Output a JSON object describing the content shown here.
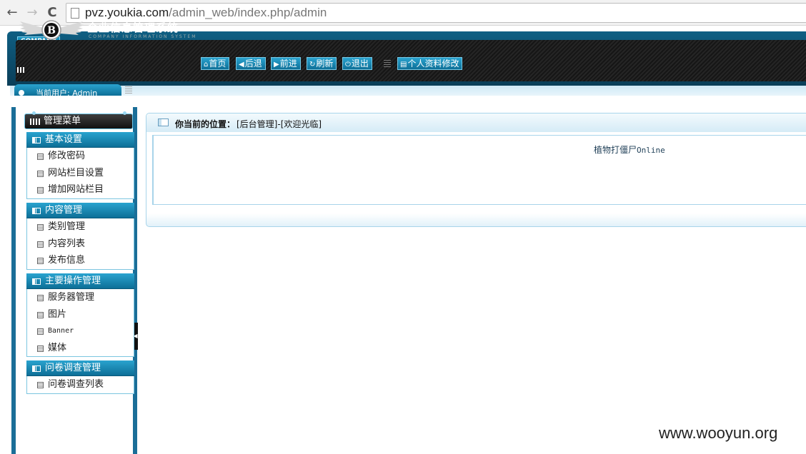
{
  "browser": {
    "back_icon": "←",
    "forward_icon": "→",
    "reload_icon": "C",
    "url_host": "pvz.youkia.com",
    "url_path": "/admin_web/index.php/admin"
  },
  "header": {
    "company_badge": "COMPANY",
    "logo_letter": "B",
    "title": "企业信息管理系统",
    "subtitle": "COMPANY INFORMATION SYSTEM",
    "toolbar": {
      "home": "首页",
      "back": "后退",
      "forward": "前进",
      "refresh": "刷新",
      "logout": "退出",
      "profile": "个人资料修改"
    }
  },
  "userbar": {
    "current_user": "当前用户: Admin"
  },
  "sidebar": {
    "title": "管理菜单",
    "sections": [
      {
        "title": "基本设置",
        "items": [
          "修改密码",
          "网站栏目设置",
          "增加网站栏目"
        ]
      },
      {
        "title": "内容管理",
        "items": [
          "类别管理",
          "内容列表",
          "发布信息"
        ]
      },
      {
        "title": "主要操作管理",
        "items": [
          "服务器管理",
          "图片",
          "Banner",
          "媒体"
        ]
      },
      {
        "title": "问卷调查管理",
        "items": [
          "问卷调查列表"
        ]
      }
    ]
  },
  "main": {
    "location_label": "你当前的位置：",
    "location_value": "[后台管理]-[欢迎光临]",
    "welcome_cn": "植物打僵尸",
    "welcome_en": "Online"
  },
  "watermark": "www.wooyun.org",
  "colors": {
    "accent": "#1a6e98",
    "button": "#0d6f97"
  }
}
